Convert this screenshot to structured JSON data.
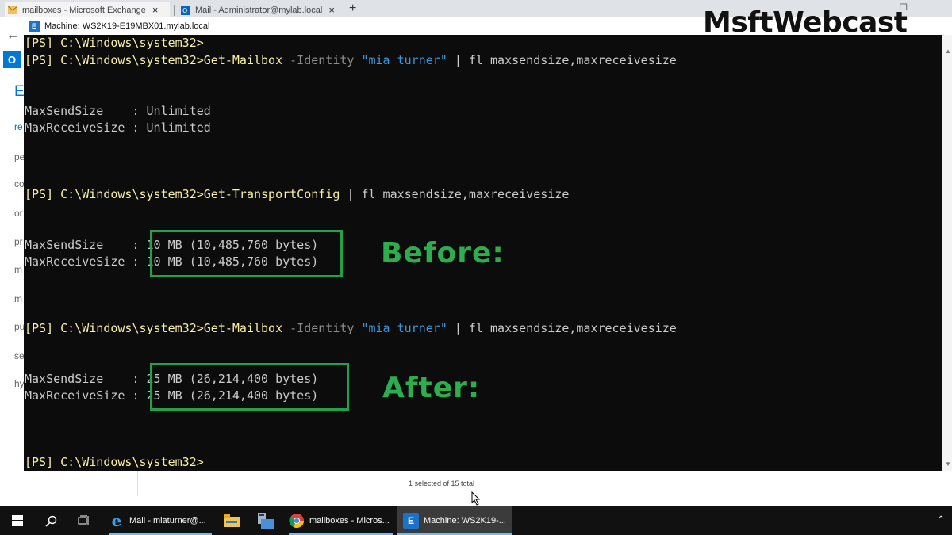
{
  "browser": {
    "tabs": [
      {
        "title": "mailboxes - Microsoft Exchange",
        "close": "×"
      },
      {
        "title": "Mail - Administrator@mylab.local",
        "close": "×"
      }
    ],
    "new_tab": "+",
    "back": "←",
    "window_restore": "❐"
  },
  "background_page": {
    "office_icon": "O",
    "heading_letter": "E",
    "nav": [
      "re",
      "pe",
      "co",
      "or",
      "pr",
      "m",
      "m",
      "pu",
      "se",
      "hy"
    ],
    "status": "1 selected of 15 total"
  },
  "remote_window": {
    "title": "Machine: WS2K19-E19MBX01.mylab.local"
  },
  "console": {
    "prompt": "[PS] C:\\Windows\\system32>",
    "cmd1": {
      "verb": "Get-Mailbox",
      "param": " -Identity ",
      "arg": "\"mia turner\"",
      "pipe": " | fl maxsendsize,maxreceivesize"
    },
    "out1": [
      {
        "name": "MaxSendSize    ",
        "sep": ": ",
        "value": "Unlimited"
      },
      {
        "name": "MaxReceiveSize ",
        "sep": ": ",
        "value": "Unlimited"
      }
    ],
    "cmd2": {
      "verb": "Get-TransportConfig",
      "pipe": " | fl maxsendsize,maxreceivesize"
    },
    "out2": [
      {
        "name": "MaxSendSize    ",
        "sep": ": ",
        "value": "10 MB (10,485,760 bytes)"
      },
      {
        "name": "MaxReceiveSize ",
        "sep": ": ",
        "value": "10 MB (10,485,760 bytes)"
      }
    ],
    "cmd3": {
      "verb": "Get-Mailbox",
      "param": " -Identity ",
      "arg": "\"mia turner\"",
      "pipe": " | fl maxsendsize,maxreceivesize"
    },
    "out3": [
      {
        "name": "MaxSendSize    ",
        "sep": ": ",
        "value": "25 MB (26,214,400 bytes)"
      },
      {
        "name": "MaxReceiveSize ",
        "sep": ": ",
        "value": "25 MB (26,214,400 bytes)"
      }
    ]
  },
  "annotations": {
    "before": "Before:",
    "after": "After:"
  },
  "watermark": "MsftWebcast",
  "taskbar": {
    "apps": [
      {
        "label": "Mail - miaturner@...",
        "icon": "edge-icon"
      },
      {
        "label": "mailboxes - Micros...",
        "icon": "chrome-icon"
      },
      {
        "label": "Machine: WS2K19-...",
        "icon": "exchange-icon"
      }
    ],
    "tray": "⌃"
  },
  "colors": {
    "console_bg": "#0c0c0c",
    "prompt": "#f9f1a5",
    "string": "#3a96dd",
    "highlight_box": "#1fa24a",
    "annotation": "#2cae4e",
    "taskbar": "#111111"
  }
}
